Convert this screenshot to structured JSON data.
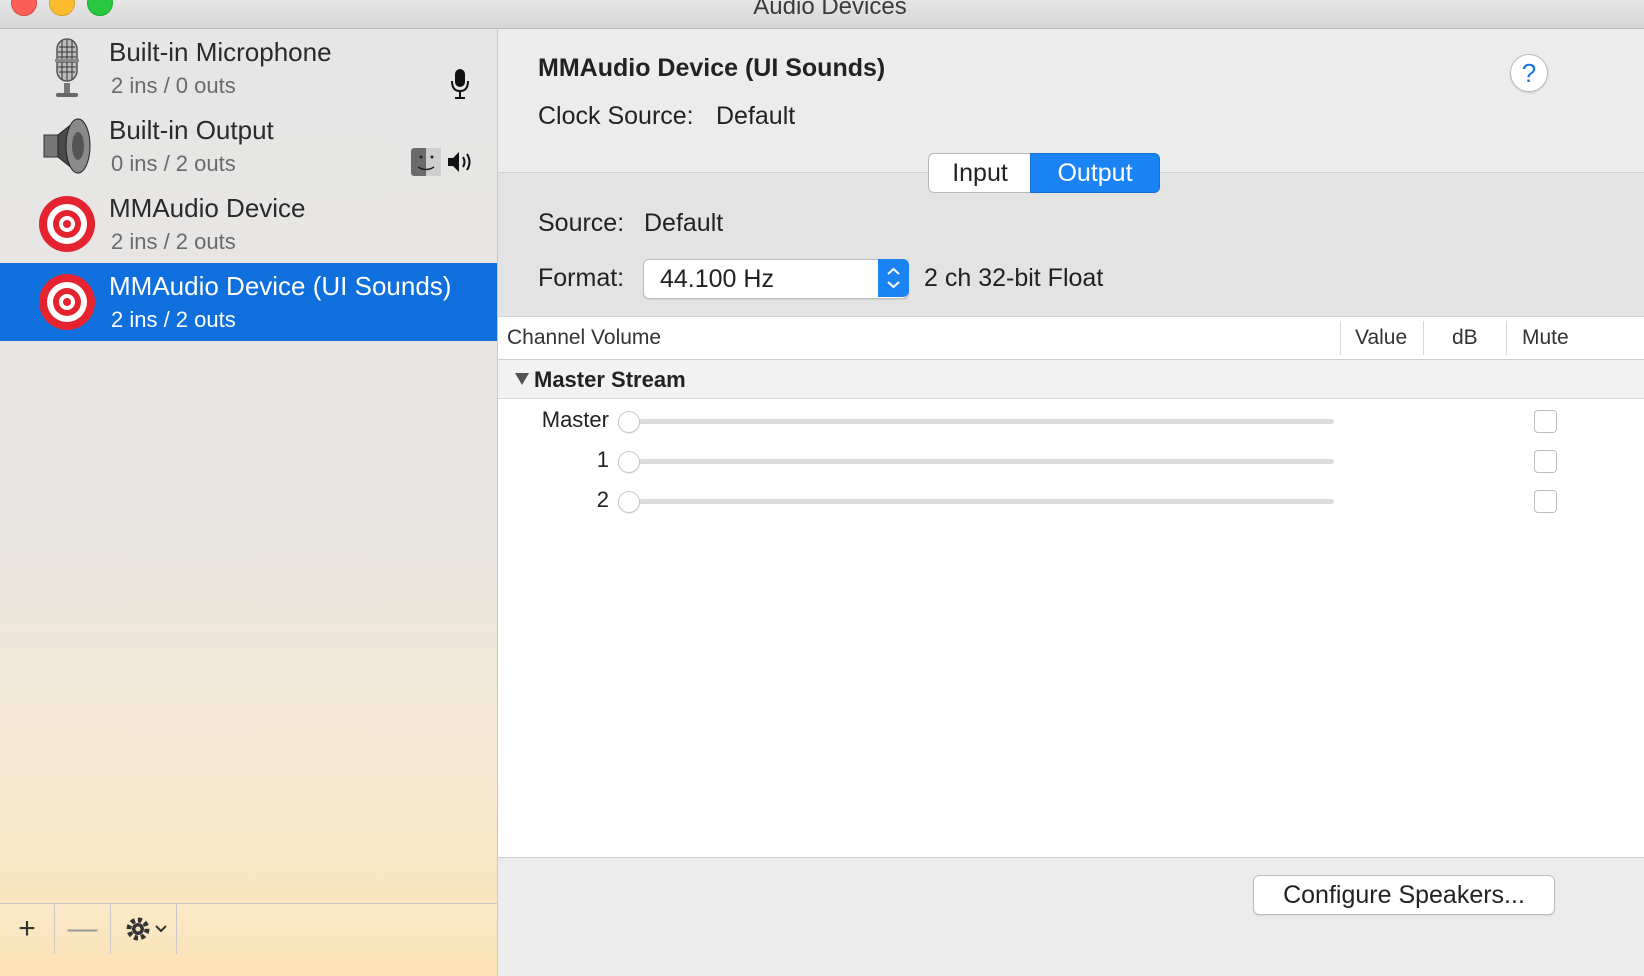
{
  "window": {
    "title": "Audio Devices"
  },
  "devices": [
    {
      "name": "Built-in Microphone",
      "io": "2 ins / 0 outs",
      "icon": "microphone-icon",
      "badges": [
        "mic-badge-icon"
      ]
    },
    {
      "name": "Built-in Output",
      "io": "0 ins / 2 outs",
      "icon": "speaker-icon",
      "badges": [
        "finder-icon",
        "speaker-badge-icon"
      ]
    },
    {
      "name": "MMAudio Device",
      "io": "2 ins / 2 outs",
      "icon": "target-icon",
      "badges": []
    },
    {
      "name": "MMAudio Device (UI Sounds)",
      "io": "2 ins / 2 outs",
      "icon": "target-icon",
      "badges": [],
      "selected": true
    }
  ],
  "sidebar_toolbar": {
    "add": "+",
    "remove": "—"
  },
  "detail": {
    "title": "MMAudio Device (UI Sounds)",
    "clock_label": "Clock Source:",
    "clock_value": "Default",
    "help": "?",
    "tabs": [
      {
        "label": "Input",
        "selected": false
      },
      {
        "label": "Output",
        "selected": true
      }
    ],
    "source_label": "Source:",
    "source_value": "Default",
    "format_label": "Format:",
    "format_rate": "44.100 Hz",
    "format_desc": "2 ch 32-bit Float"
  },
  "table": {
    "headers": {
      "channel": "Channel Volume",
      "value": "Value",
      "db": "dB",
      "mute": "Mute"
    },
    "group": "Master Stream",
    "rows": [
      {
        "label": "Master",
        "muted": false
      },
      {
        "label": "1",
        "muted": false
      },
      {
        "label": "2",
        "muted": false
      }
    ]
  },
  "configure_button": "Configure Speakers...",
  "colors": {
    "accent": "#1b84f5",
    "selection": "#0f6fdd",
    "target_red": "#e4232e"
  }
}
